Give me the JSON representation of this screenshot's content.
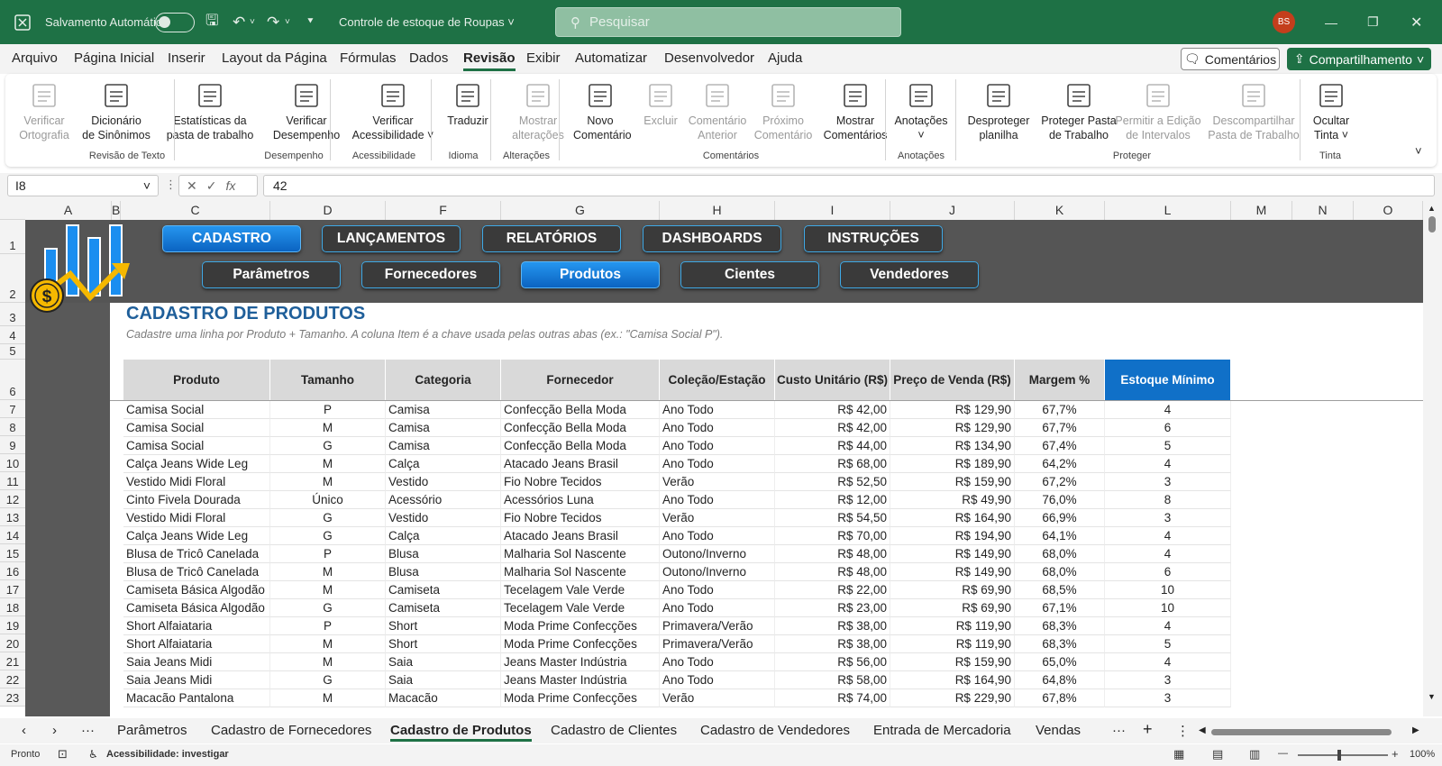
{
  "titlebar": {
    "autosave_label": "Salvamento Automático",
    "workbook_name": "Controle de estoque de Roupas",
    "search_placeholder": "Pesquisar",
    "avatar_initials": "BS"
  },
  "menu": {
    "items": [
      "Arquivo",
      "Página Inicial",
      "Inserir",
      "Layout da Página",
      "Fórmulas",
      "Dados",
      "Revisão",
      "Exibir",
      "Automatizar",
      "Desenvolvedor",
      "Ajuda"
    ],
    "active": "Revisão",
    "comments_label": "Comentários",
    "share_label": "Compartilhamento"
  },
  "ribbon": {
    "buttons": [
      {
        "label1": "Verificar",
        "label2": "Ortografia",
        "disabled": true,
        "icon": "spelling-icon"
      },
      {
        "label1": "Dicionário",
        "label2": "de Sinônimos",
        "disabled": false,
        "icon": "thesaurus-icon"
      },
      {
        "label1": "Estatísticas da",
        "label2": "pasta de trabalho",
        "disabled": false,
        "icon": "workbook-stats-icon"
      },
      {
        "label1": "Verificar",
        "label2": "Desempenho",
        "disabled": false,
        "icon": "performance-icon"
      },
      {
        "label1": "Verificar",
        "label2": "Acessibilidade ˅",
        "disabled": false,
        "icon": "accessibility-icon"
      },
      {
        "label1": "Traduzir",
        "label2": "",
        "disabled": false,
        "icon": "translate-icon"
      },
      {
        "label1": "Mostrar",
        "label2": "alterações",
        "disabled": true,
        "icon": "show-changes-icon"
      },
      {
        "label1": "Novo",
        "label2": "Comentário",
        "disabled": false,
        "icon": "new-comment-icon"
      },
      {
        "label1": "Excluir",
        "label2": "",
        "disabled": true,
        "icon": "delete-comment-icon"
      },
      {
        "label1": "Comentário",
        "label2": "Anterior",
        "disabled": true,
        "icon": "previous-comment-icon"
      },
      {
        "label1": "Próximo",
        "label2": "Comentário",
        "disabled": true,
        "icon": "next-comment-icon"
      },
      {
        "label1": "Mostrar",
        "label2": "Comentários",
        "disabled": false,
        "icon": "show-comments-icon"
      },
      {
        "label1": "Anotações",
        "label2": "˅",
        "disabled": false,
        "icon": "notes-icon"
      },
      {
        "label1": "Desproteger",
        "label2": "planilha",
        "disabled": false,
        "icon": "unprotect-sheet-icon"
      },
      {
        "label1": "Proteger Pasta",
        "label2": "de Trabalho",
        "disabled": false,
        "icon": "protect-workbook-icon"
      },
      {
        "label1": "Permitir a Edição",
        "label2": "de Intervalos",
        "disabled": true,
        "icon": "allow-edit-ranges-icon"
      },
      {
        "label1": "Descompartilhar",
        "label2": "Pasta de Trabalho",
        "disabled": true,
        "icon": "unshare-workbook-icon"
      },
      {
        "label1": "Ocultar",
        "label2": "Tinta ˅",
        "disabled": false,
        "icon": "hide-ink-icon"
      }
    ],
    "groups": [
      "Revisão de Texto",
      "Desempenho",
      "Acessibilidade",
      "Idioma",
      "Alterações",
      "Comentários",
      "Anotações",
      "Proteger",
      "Tinta"
    ]
  },
  "formula_bar": {
    "name_box": "I8",
    "fx": "fx",
    "value": "42"
  },
  "columns": [
    "A",
    "B",
    "C",
    "D",
    "F",
    "G",
    "H",
    "I",
    "J",
    "K",
    "L",
    "M",
    "N",
    "O"
  ],
  "rows": [
    "1",
    "2",
    "3",
    "4",
    "5",
    "6",
    "7",
    "8",
    "9",
    "10",
    "11",
    "12",
    "13",
    "14",
    "15",
    "16",
    "17",
    "18",
    "19",
    "20",
    "21",
    "22",
    "23"
  ],
  "nav": {
    "top": [
      "CADASTRO",
      "LANÇAMENTOS",
      "RELATÓRIOS",
      "DASHBOARDS",
      "INSTRUÇÕES"
    ],
    "bottom": [
      "Parâmetros",
      "Fornecedores",
      "Produtos",
      "Cientes",
      "Vendedores"
    ]
  },
  "sheet": {
    "title": "CADASTRO DE PRODUTOS",
    "subtitle": "Cadastre uma linha por Produto + Tamanho. A coluna Item é a chave usada pelas outras abas (ex.: \"Camisa Social P\")."
  },
  "table": {
    "headers": [
      "Produto",
      "Tamanho",
      "Categoria",
      "Fornecedor",
      "Coleção/Estação",
      "Custo Unitário (R$)",
      "Preço de Venda (R$)",
      "Margem %",
      "Estoque Mínimo"
    ],
    "rows": [
      [
        "Camisa Social",
        "P",
        "Camisa",
        "Confecção Bella Moda",
        "Ano Todo",
        "R$ 42,00",
        "R$ 129,90",
        "67,7%",
        "4"
      ],
      [
        "Camisa Social",
        "M",
        "Camisa",
        "Confecção Bella Moda",
        "Ano Todo",
        "R$ 42,00",
        "R$ 129,90",
        "67,7%",
        "6"
      ],
      [
        "Camisa Social",
        "G",
        "Camisa",
        "Confecção Bella Moda",
        "Ano Todo",
        "R$ 44,00",
        "R$ 134,90",
        "67,4%",
        "5"
      ],
      [
        "Calça Jeans Wide Leg",
        "M",
        "Calça",
        "Atacado Jeans Brasil",
        "Ano Todo",
        "R$ 68,00",
        "R$ 189,90",
        "64,2%",
        "4"
      ],
      [
        "Vestido Midi Floral",
        "M",
        "Vestido",
        "Fio Nobre Tecidos",
        "Verão",
        "R$ 52,50",
        "R$ 159,90",
        "67,2%",
        "3"
      ],
      [
        "Cinto Fivela Dourada",
        "Único",
        "Acessório",
        "Acessórios Luna",
        "Ano Todo",
        "R$ 12,00",
        "R$ 49,90",
        "76,0%",
        "8"
      ],
      [
        "Vestido Midi Floral",
        "G",
        "Vestido",
        "Fio Nobre Tecidos",
        "Verão",
        "R$ 54,50",
        "R$ 164,90",
        "66,9%",
        "3"
      ],
      [
        "Calça Jeans Wide Leg",
        "G",
        "Calça",
        "Atacado Jeans Brasil",
        "Ano Todo",
        "R$ 70,00",
        "R$ 194,90",
        "64,1%",
        "4"
      ],
      [
        "Blusa de Tricô Canelada",
        "P",
        "Blusa",
        "Malharia Sol Nascente",
        "Outono/Inverno",
        "R$ 48,00",
        "R$ 149,90",
        "68,0%",
        "4"
      ],
      [
        "Blusa de Tricô Canelada",
        "M",
        "Blusa",
        "Malharia Sol Nascente",
        "Outono/Inverno",
        "R$ 48,00",
        "R$ 149,90",
        "68,0%",
        "6"
      ],
      [
        "Camiseta Básica Algodão",
        "M",
        "Camiseta",
        "Tecelagem Vale Verde",
        "Ano Todo",
        "R$ 22,00",
        "R$ 69,90",
        "68,5%",
        "10"
      ],
      [
        "Camiseta Básica Algodão",
        "G",
        "Camiseta",
        "Tecelagem Vale Verde",
        "Ano Todo",
        "R$ 23,00",
        "R$ 69,90",
        "67,1%",
        "10"
      ],
      [
        "Short Alfaiataria",
        "P",
        "Short",
        "Moda Prime Confecções",
        "Primavera/Verão",
        "R$ 38,00",
        "R$ 119,90",
        "68,3%",
        "4"
      ],
      [
        "Short Alfaiataria",
        "M",
        "Short",
        "Moda Prime Confecções",
        "Primavera/Verão",
        "R$ 38,00",
        "R$ 119,90",
        "68,3%",
        "5"
      ],
      [
        "Saia Jeans Midi",
        "M",
        "Saia",
        "Jeans Master Indústria",
        "Ano Todo",
        "R$ 56,00",
        "R$ 159,90",
        "65,0%",
        "4"
      ],
      [
        "Saia Jeans Midi",
        "G",
        "Saia",
        "Jeans Master Indústria",
        "Ano Todo",
        "R$ 58,00",
        "R$ 164,90",
        "64,8%",
        "3"
      ],
      [
        "Macacão Pantalona",
        "M",
        "Macacão",
        "Moda Prime Confecções",
        "Verão",
        "R$ 74,00",
        "R$ 229,90",
        "67,8%",
        "3"
      ]
    ]
  },
  "tabs": {
    "items": [
      "Parâmetros",
      "Cadastro de Fornecedores",
      "Cadastro de Produtos",
      "Cadastro de Clientes",
      "Cadastro de Vendedores",
      "Entrada de Mercadoria",
      "Vendas"
    ],
    "active": "Cadastro de Produtos"
  },
  "status": {
    "ready": "Pronto",
    "accessibility": "Acessibilidade: investigar",
    "zoom": "100%"
  },
  "colors": {
    "excel_green": "#1e7145",
    "header_blue": "#1070c8",
    "dark_band": "#555555"
  }
}
